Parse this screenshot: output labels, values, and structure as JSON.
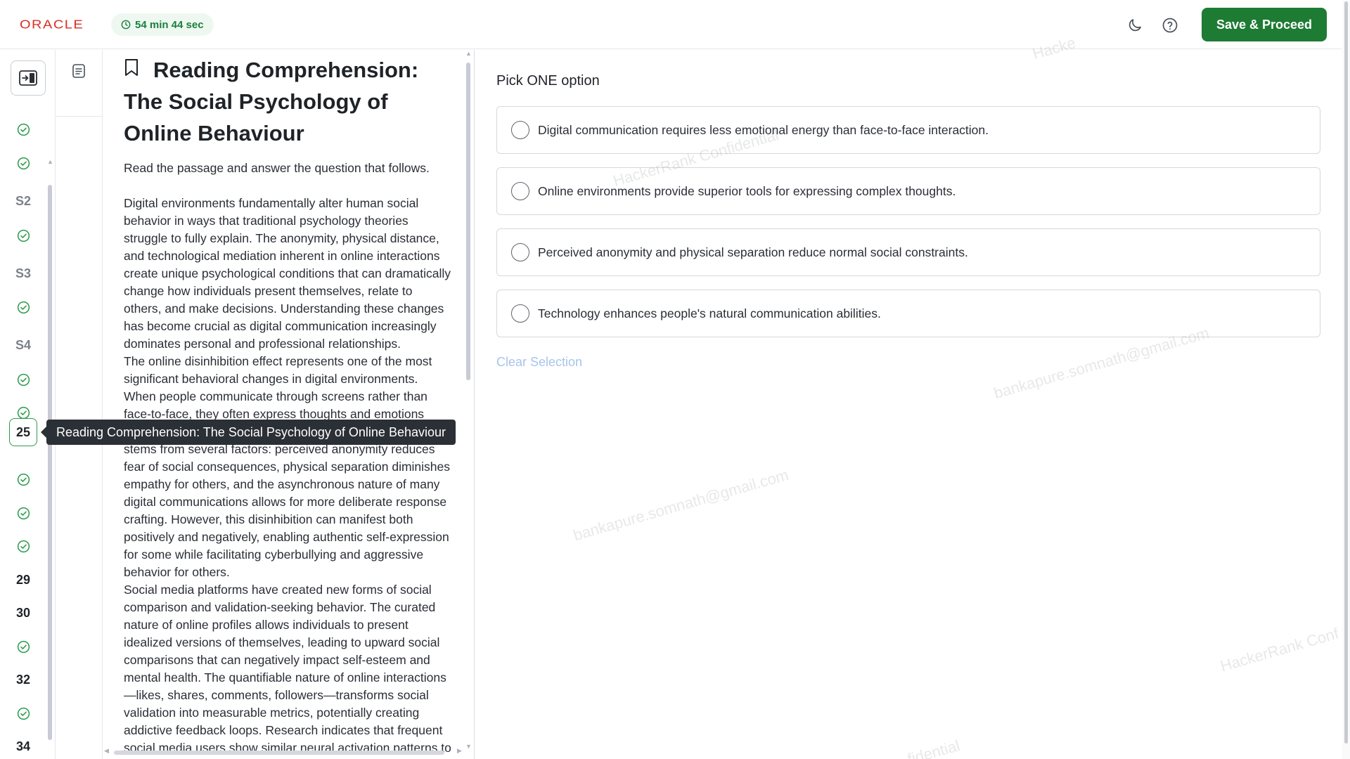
{
  "header": {
    "logo": "ORACLE",
    "timer": "54 min 44 sec",
    "save_label": "Save & Proceed"
  },
  "rail": {
    "items": [
      {
        "type": "check"
      },
      {
        "type": "check"
      },
      {
        "type": "section",
        "label": "S2"
      },
      {
        "type": "check"
      },
      {
        "type": "section",
        "label": "S3"
      },
      {
        "type": "check"
      },
      {
        "type": "section",
        "label": "S4"
      },
      {
        "type": "check"
      },
      {
        "type": "check"
      },
      {
        "type": "current",
        "label": "25"
      },
      {
        "type": "check"
      },
      {
        "type": "check"
      },
      {
        "type": "check"
      },
      {
        "type": "number",
        "label": "29"
      },
      {
        "type": "number",
        "label": "30"
      },
      {
        "type": "check"
      },
      {
        "type": "number",
        "label": "32"
      },
      {
        "type": "check"
      },
      {
        "type": "number",
        "label": "34"
      }
    ],
    "label_s2": "S2",
    "label_s3": "S3",
    "label_s4": "S4",
    "label_25": "25",
    "label_29": "29",
    "label_30": "30",
    "label_32": "32",
    "label_34": "34"
  },
  "tooltip": "Reading Comprehension: The Social Psychology of Online Behaviour",
  "passage": {
    "title": "Reading Comprehension: The Social Psychology of Online Behaviour",
    "instruction": "Read the passage and answer the question that follows.",
    "paragraphs": [
      "Digital environments fundamentally alter human social behavior in ways that traditional psychology theories struggle to fully explain. The anonymity, physical distance, and technological mediation inherent in online interactions create unique psychological conditions that can dramatically change how individuals present themselves, relate to others, and make decisions. Understanding these changes has become crucial as digital communication increasingly dominates personal and professional relationships.",
      "The online disinhibition effect represents one of the most significant behavioral changes in digital environments. When people communicate through screens rather than face-to-face, they often express thoughts and emotions more freely than they would in person. This phenomenon stems from several factors: perceived anonymity reduces fear of social consequences, physical separation diminishes empathy for others, and the asynchronous nature of many digital communications allows for more deliberate response crafting. However, this disinhibition can manifest both positively and negatively, enabling authentic self-expression for some while facilitating cyberbullying and aggressive behavior for others.",
      "Social media platforms have created new forms of social comparison and validation-seeking behavior. The curated nature of online profiles allows individuals to present idealized versions of themselves, leading to upward social comparisons that can negatively impact self-esteem and mental health. The quantifiable nature of online interactions—likes, shares, comments, followers—transforms social validation into measurable metrics, potentially creating addictive feedback loops. Research indicates that frequent social media users show similar neural activation patterns to"
    ]
  },
  "question": {
    "prompt": "Pick ONE option",
    "options": [
      "Digital communication requires less emotional energy than face-to-face interaction.",
      "Online environments provide superior tools for expressing complex thoughts.",
      "Perceived anonymity and physical separation reduce normal social constraints.",
      "Technology enhances people's natural communication abilities."
    ],
    "clear_label": "Clear Selection"
  },
  "watermarks": {
    "email": "bankapure.somnath@gmail.com",
    "confidential": "HackerRank Confidential",
    "conf_partial_1": "Hacke",
    "conf_partial_2": "HackerRank Conf",
    "conf_partial_3": "fidential"
  },
  "colors": {
    "brand_red": "#d93025",
    "accent_green": "#1e7b34",
    "check_green": "#2b9b4c",
    "link_blue": "#a9c4ec"
  }
}
